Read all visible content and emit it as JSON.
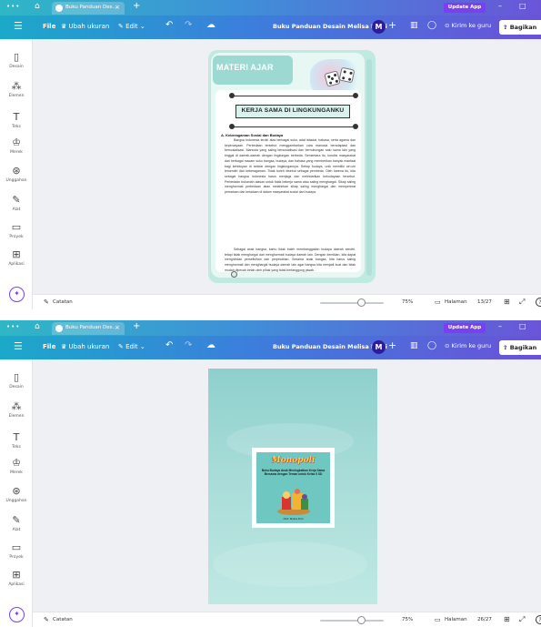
{
  "browser": {
    "tab_title": "Buku Panduan Des...",
    "tab_close": "×",
    "new_tab": "+",
    "upgrade_label": "Update App",
    "menu_dots": "•••",
    "minimize": "–",
    "maximize": "□"
  },
  "header": {
    "file_label": "File",
    "resize_label": "Ubah ukuran",
    "edit_label": "Edit",
    "document_title": "Buku Panduan Desain Melisa Putri",
    "avatar_initial": "M",
    "plus_label": "+",
    "send_teacher_label": "Kirim ke guru",
    "share_label": "Bagikan",
    "share_label_cut": "Bagikan"
  },
  "sidebar": {
    "items": [
      {
        "label": "Desain",
        "icon": "layout-icon"
      },
      {
        "label": "Elemen",
        "icon": "elements-icon"
      },
      {
        "label": "Teks",
        "icon": "text-icon"
      },
      {
        "label": "Merek",
        "icon": "brand-icon"
      },
      {
        "label": "Unggahan",
        "icon": "upload-icon"
      },
      {
        "label": "Alat",
        "icon": "draw-icon"
      },
      {
        "label": "Proyek",
        "icon": "folder-icon"
      },
      {
        "label": "Aplikasi",
        "icon": "apps-icon"
      }
    ]
  },
  "bottombar": {
    "notes_label": "Catatan",
    "zoom_value": "75%",
    "zoom_fraction": 0.75,
    "pages_label": "Halaman"
  },
  "screen1": {
    "page_count": "13/27",
    "page": {
      "header_title": "MATERI AJAR",
      "banner_title": "KERJA SAMA DI LINGKUNGANKU",
      "section_title": "A. Keberagaman Sosial dan Budaya",
      "paragraph1": "Bangsa Indonesia terdiri atas berbagai suku, adat istiadat, bahasa, serta agama dan kepercayaan. Perbedaan tersebut menggambarkan cara manusia beradaptasi dan bersosialisasi. Manusia yang saling bersosialisasi dan berhubungan satu sama lain yang tinggal di daerah-daerah dengan lingkungan berbeda. Sementara itu, kondisi masyarakat dari berbagai macam suku bangsa, budaya, dan bahasa yang memberikan banyak manfaat bagi kehidupan di sekitar dengan lingkungannya. Setiap budaya, unik memiliki ciri-ciri tersendiri dan keberagaman. Tidak boleh disebut sebagai pembeda. Oleh karena itu, kita sebagai bangsa Indonesia harus menjaga dan melestarikan kebudayaan tersebut. Perbedaan bukanlah alasan untuk tidak bekerja sama atau saling menghargai. Sikap saling menghormati perbedaan akan melahirkan sikap saling menghargai dan mempererat persatuan dan kesatuan di dalam masyarakat sosial dan budaya.",
      "paragraph2": "Sebagai anak bangsa, kamu tidak boleh membanggakan budaya daerah sendiri, tetapi tidak menghargai dan menghormati budaya daerah lain. Dengan demikian, kita dapat menghindari perselisihan dan perpecahan. Sesama anak bangsa, kita harus saling menghormati dan menghargai budaya daerah lain agar bangsa kita menjadi kuat dan tidak mudah dipecah belah oleh pihak yang tidak bertanggung jawab."
    }
  },
  "screen2": {
    "page_count": "26/27",
    "cover": {
      "title": "Monopoli",
      "subtitle": "Buku Budaya Anak Meningkatkan Kerja Sama Bersama dengan Teman untuk Kelas 5 SD",
      "author": "Oleh: Melisa Putri"
    }
  }
}
